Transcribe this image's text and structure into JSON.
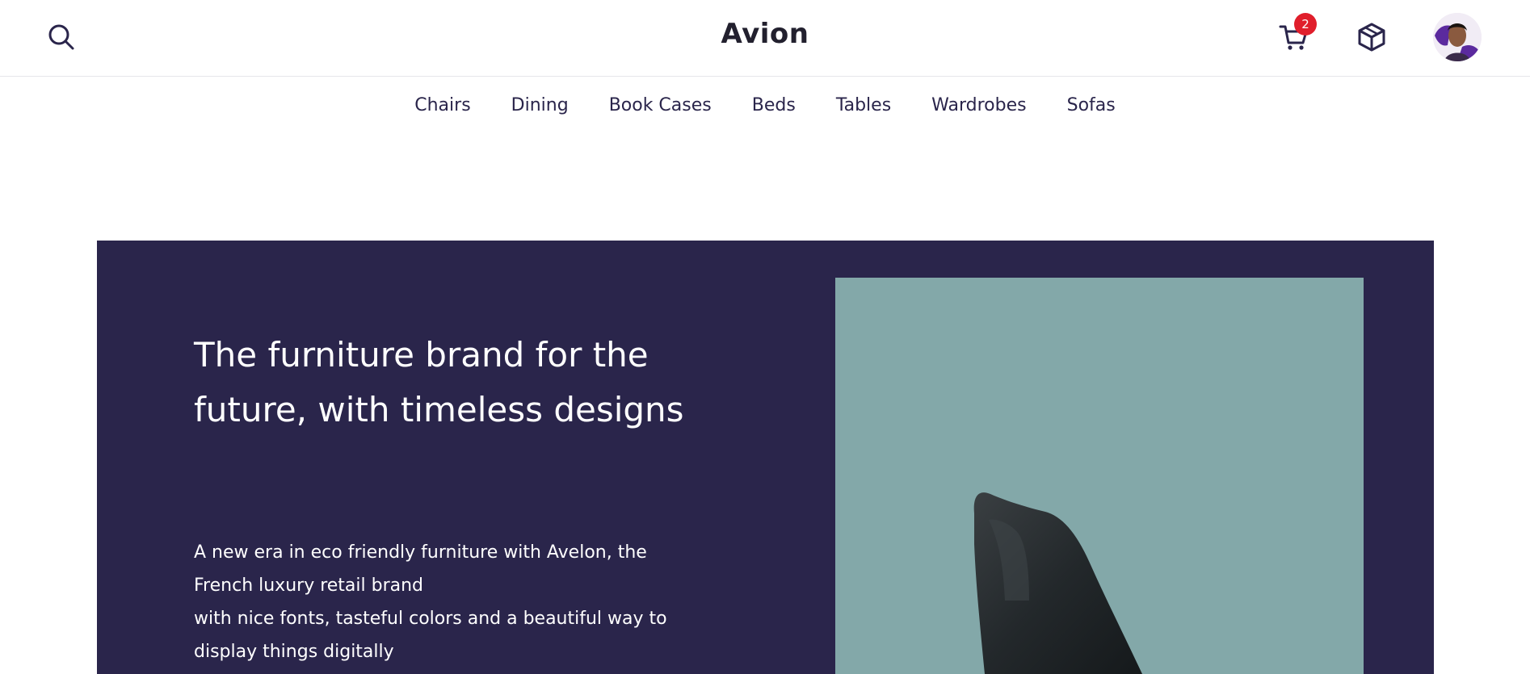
{
  "header": {
    "brand": "Avion",
    "cart_count": "2",
    "icons": {
      "search": "search-icon",
      "cart": "cart-icon",
      "box": "package-icon",
      "avatar": "user-avatar"
    }
  },
  "nav": {
    "items": [
      "Chairs",
      "Dining",
      "Book Cases",
      "Beds",
      "Tables",
      "Wardrobes",
      "Sofas"
    ]
  },
  "hero": {
    "title": "The furniture brand for the future, with timeless designs",
    "body_line1": "A new era in eco friendly furniture with Avelon, the French luxury retail brand",
    "body_line2": "with nice fonts, tasteful colors and a beautiful way to display things digitally"
  },
  "colors": {
    "hero_bg": "#2a254b",
    "image_bg": "#83a8a9",
    "badge": "#e01e2b",
    "text": "#2a254b"
  }
}
